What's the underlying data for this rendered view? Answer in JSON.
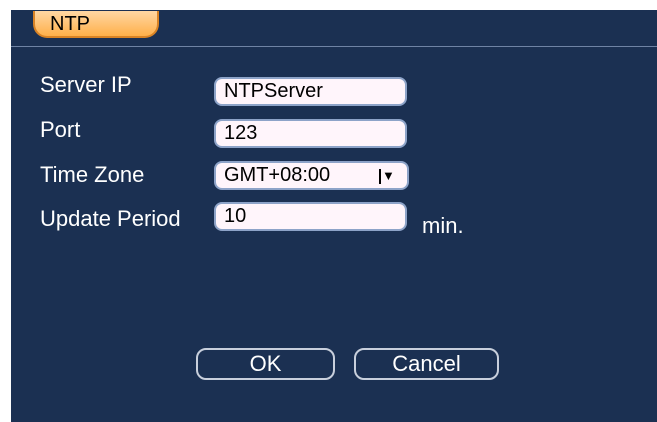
{
  "title": "NTP",
  "fields": [
    {
      "label": "Server IP",
      "value": "NTPServer"
    },
    {
      "label": "Port",
      "value": "123"
    },
    {
      "label": "Time Zone",
      "value": "GMT+08:00"
    },
    {
      "label": "Update Period",
      "value": "10",
      "unit": "min."
    }
  ],
  "buttons": {
    "ok": "OK",
    "cancel": "Cancel"
  },
  "colors": {
    "background": "#1b3052",
    "tab": "#ffb04a",
    "field": "#fff5fb"
  }
}
